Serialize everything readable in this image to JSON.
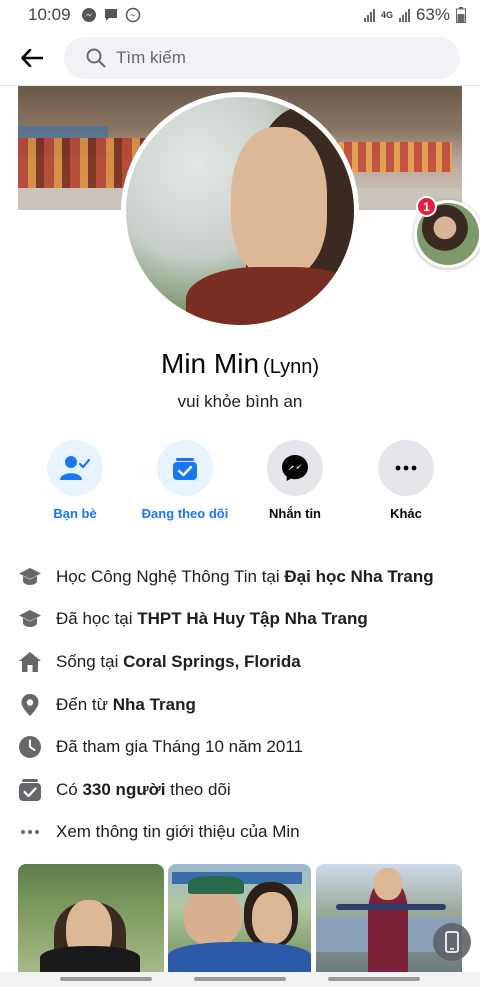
{
  "status_bar": {
    "time": "10:09",
    "network": "4G",
    "battery": "63%"
  },
  "header": {
    "search_placeholder": "Tìm kiếm"
  },
  "chat_head": {
    "badge_count": "1"
  },
  "profile": {
    "name": "Min Min",
    "alt_name": "(Lynn)",
    "bio": "vui khỏe bình an"
  },
  "actions": [
    {
      "label": "Bạn bè",
      "icon": "friends-check-icon"
    },
    {
      "label": "Đang theo dõi",
      "icon": "following-check-icon"
    },
    {
      "label": "Nhắn tin",
      "icon": "messenger-icon"
    },
    {
      "label": "Khác",
      "icon": "more-dots-icon"
    }
  ],
  "info": [
    {
      "icon": "graduation-cap-icon",
      "prefix": "Học Công Nghệ Thông Tin tại ",
      "bold": "Đại học Nha Trang",
      "suffix": ""
    },
    {
      "icon": "graduation-cap-icon",
      "prefix": "Đã học tại ",
      "bold": "THPT Hà Huy Tập Nha Trang",
      "suffix": ""
    },
    {
      "icon": "home-icon",
      "prefix": "Sống tại ",
      "bold": "Coral Springs, Florida",
      "suffix": ""
    },
    {
      "icon": "location-pin-icon",
      "prefix": "Đến từ ",
      "bold": "Nha Trang",
      "suffix": ""
    },
    {
      "icon": "clock-icon",
      "prefix": "Đã tham gia Tháng 10 năm 2011",
      "bold": "",
      "suffix": ""
    },
    {
      "icon": "followers-check-icon",
      "prefix": "Có ",
      "bold": "330 người",
      "suffix": " theo dõi"
    },
    {
      "icon": "more-dots-icon",
      "prefix": "Xem thông tin giới thiệu của Min",
      "bold": "",
      "suffix": ""
    }
  ],
  "colors": {
    "accent": "#1877f2",
    "accent_light": "#e7f3ff",
    "badge": "#e41e3f"
  }
}
